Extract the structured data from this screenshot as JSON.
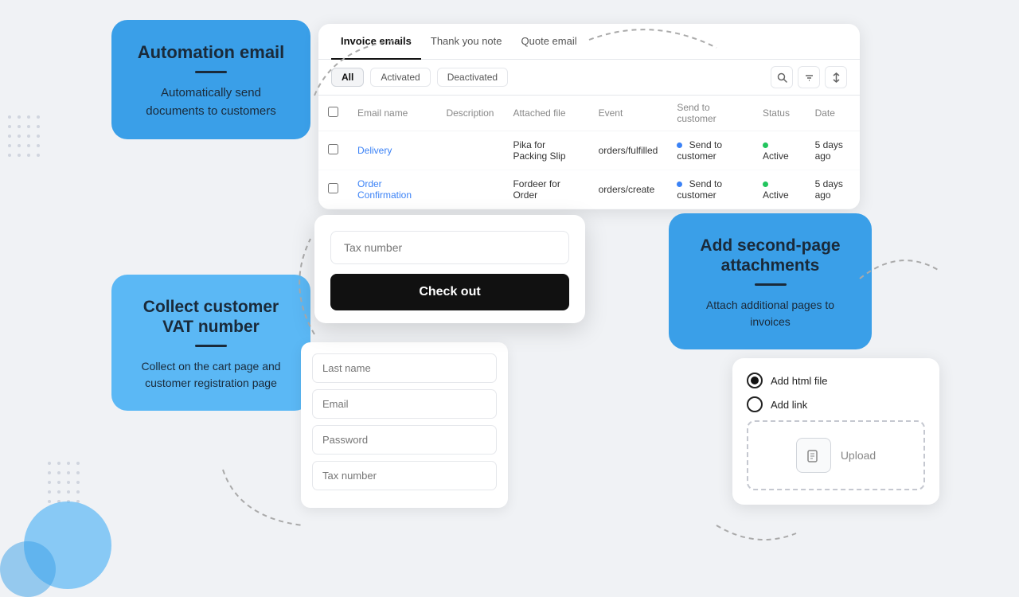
{
  "page": {
    "background": "#f0f2f5"
  },
  "card_automation": {
    "title": "Automation email",
    "divider": true,
    "description": "Automatically send documents to customers"
  },
  "email_table": {
    "tabs": [
      {
        "label": "Invoice emails",
        "active": true
      },
      {
        "label": "Thank you note",
        "active": false
      },
      {
        "label": "Quote email",
        "active": false
      }
    ],
    "filters": [
      {
        "label": "All",
        "active": true
      },
      {
        "label": "Activated",
        "active": false
      },
      {
        "label": "Deactivated",
        "active": false
      }
    ],
    "columns": [
      "Email name",
      "Description",
      "Attached file",
      "Event",
      "Send to customer",
      "Status",
      "Date"
    ],
    "rows": [
      {
        "name": "Delivery",
        "description": "",
        "attached_file": "Pika for Packing Slip",
        "event": "orders/fulfilled",
        "send_to": "Send to customer",
        "status": "Active",
        "date": "5 days ago"
      },
      {
        "name": "Order Confirmation",
        "description": "",
        "attached_file": "Fordeer for Order",
        "event": "orders/create",
        "send_to": "Send to customer",
        "status": "Active",
        "date": "5 days ago"
      }
    ]
  },
  "card_vat": {
    "title": "Collect customer VAT number",
    "divider": true,
    "description": "Collect on the cart page and customer registration page"
  },
  "checkout_form": {
    "tax_number_placeholder": "Tax number",
    "checkout_button": "Check out"
  },
  "register_form": {
    "fields": [
      {
        "placeholder": "Last name"
      },
      {
        "placeholder": "Email"
      },
      {
        "placeholder": "Password"
      },
      {
        "placeholder": "Tax number"
      }
    ]
  },
  "card_attachments": {
    "title": "Add second-page attachments",
    "description": "Attach additional pages to invoices"
  },
  "upload_card": {
    "options": [
      {
        "label": "Add html file",
        "selected": true
      },
      {
        "label": "Add link",
        "selected": false
      }
    ],
    "upload_label": "Upload"
  }
}
